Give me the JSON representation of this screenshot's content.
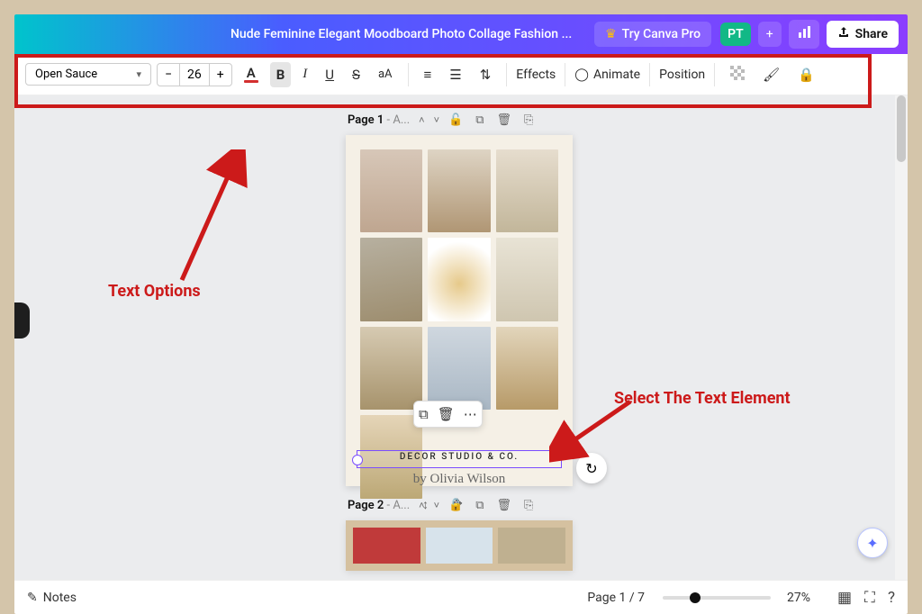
{
  "header": {
    "title": "Nude Feminine Elegant Moodboard Photo Collage Fashion ...",
    "try_pro": "Try Canva Pro",
    "profile_initials": "PT",
    "share_label": "Share"
  },
  "toolbar": {
    "font": "Open Sauce",
    "size": "26",
    "effects": "Effects",
    "animate": "Animate",
    "position": "Position"
  },
  "annotations": {
    "text_options": "Text Options",
    "select_text": "Select The Text Element"
  },
  "page1": {
    "label_prefix": "Page 1",
    "label_suffix": " - A...",
    "selected_text": "DECOR STUDIO & CO.",
    "byline": "by Olivia Wilson"
  },
  "page2": {
    "label_prefix": "Page 2",
    "label_suffix": " - A..."
  },
  "footer": {
    "notes": "Notes",
    "page_counter": "Page 1 / 7",
    "zoom": "27%"
  }
}
